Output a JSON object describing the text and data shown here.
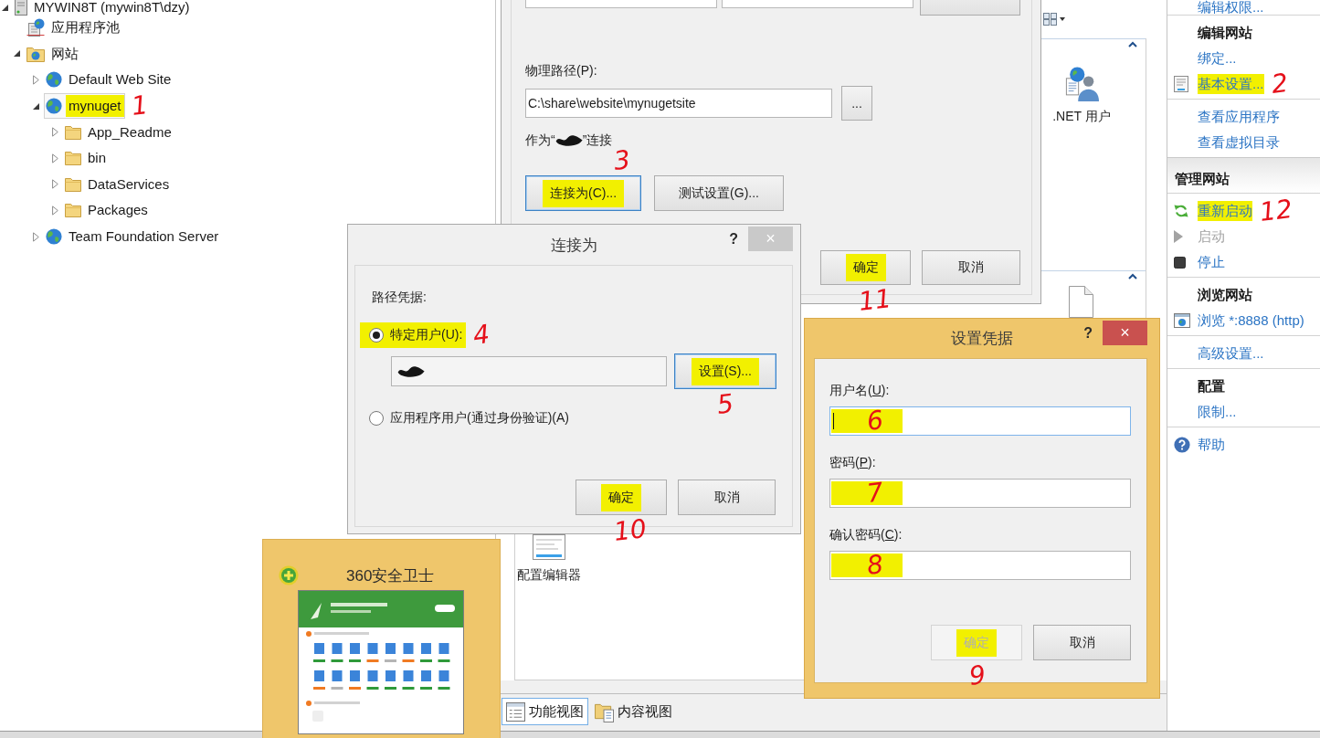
{
  "tree": {
    "items": [
      {
        "label": "MYWIN8T (mywin8T\\dzy)",
        "kind": "server",
        "expanded": true,
        "selected": false,
        "highlighted": false,
        "children": [
          {
            "label": "应用程序池",
            "kind": "pool",
            "selected": false,
            "highlighted": false
          },
          {
            "label": "网站",
            "kind": "sites",
            "expanded": true,
            "selected": false,
            "highlighted": false,
            "children": [
              {
                "label": "Default Web Site",
                "kind": "globe",
                "expanded": false,
                "selected": false,
                "highlighted": false
              },
              {
                "label": "mynuget",
                "kind": "globe",
                "expanded": true,
                "selected": true,
                "highlighted": true,
                "annotation": "1",
                "children": [
                  {
                    "label": "App_Readme",
                    "kind": "folder",
                    "expanded": false,
                    "selected": false,
                    "highlighted": false
                  },
                  {
                    "label": "bin",
                    "kind": "folder",
                    "expanded": false,
                    "selected": false,
                    "highlighted": false
                  },
                  {
                    "label": "DataServices",
                    "kind": "folder",
                    "expanded": false,
                    "selected": false,
                    "highlighted": false
                  },
                  {
                    "label": "Packages",
                    "kind": "folder",
                    "expanded": false,
                    "selected": false,
                    "highlighted": false
                  }
                ]
              },
              {
                "label": "Team Foundation Server",
                "kind": "globe",
                "expanded": false,
                "selected": false,
                "highlighted": false
              }
            ]
          }
        ]
      }
    ]
  },
  "site_dialog": {
    "top_row": [
      {
        "kind": "field"
      },
      {
        "kind": "field"
      },
      {
        "kind": "button"
      }
    ],
    "path_label": "物理路径(P):",
    "path_value": "C:\\share\\website\\mynugetsite",
    "browse_label": "...",
    "connect_note": {
      "before": "作为“",
      "after": "”连接",
      "redacted": true
    },
    "buttons": [
      {
        "label": "连接为(C)...",
        "focused": true,
        "disabled": false,
        "highlighted": true,
        "annotation": "3"
      },
      {
        "label": "测试设置(G)...",
        "focused": false,
        "disabled": false,
        "highlighted": false
      }
    ],
    "footer_buttons": [
      {
        "label": "确定",
        "focused": false,
        "disabled": false,
        "highlighted": true,
        "annotation": "11"
      },
      {
        "label": "取消",
        "focused": false,
        "disabled": false,
        "highlighted": false
      }
    ]
  },
  "feature_sections": [
    {
      "expanded": true,
      "tiles": [
        {
          "kind": "users",
          "label": ".NET 用户"
        }
      ]
    },
    {
      "expanded": true,
      "tiles": [
        {
          "kind": "document"
        }
      ]
    }
  ],
  "lower_tiles": [
    {
      "kind": "config",
      "label": "配置编辑器"
    }
  ],
  "actions": [
    {
      "kind": "block",
      "items": [
        {
          "kind": "link",
          "label": "编辑权限...",
          "disabled": false,
          "highlighted": false
        }
      ]
    },
    {
      "kind": "block",
      "items": [
        {
          "kind": "heading",
          "label": "编辑网站"
        },
        {
          "kind": "link",
          "label": "绑定...",
          "disabled": false,
          "highlighted": false
        },
        {
          "kind": "form",
          "label": "基本设置...",
          "disabled": false,
          "highlighted": true,
          "annotation": "2"
        }
      ]
    },
    {
      "kind": "block",
      "items": [
        {
          "kind": "link",
          "label": "查看应用程序",
          "disabled": false,
          "highlighted": false
        },
        {
          "kind": "link",
          "label": "查看虚拟目录",
          "disabled": false,
          "highlighted": false
        }
      ]
    },
    {
      "kind": "group",
      "label": "管理网站"
    },
    {
      "kind": "block",
      "items": [
        {
          "kind": "refresh",
          "label": "重新启动",
          "disabled": false,
          "highlighted": true,
          "annotation": "12"
        },
        {
          "kind": "play",
          "label": "启动",
          "disabled": true,
          "highlighted": false
        },
        {
          "kind": "stop",
          "label": "停止",
          "disabled": false,
          "highlighted": false
        }
      ]
    },
    {
      "kind": "block",
      "items": [
        {
          "kind": "heading",
          "label": "浏览网站"
        },
        {
          "kind": "browse",
          "label": "浏览 *:8888 (http)",
          "disabled": false,
          "highlighted": false
        }
      ]
    },
    {
      "kind": "block",
      "items": [
        {
          "kind": "link",
          "label": "高级设置...",
          "disabled": false,
          "highlighted": false
        }
      ]
    },
    {
      "kind": "block",
      "items": [
        {
          "kind": "heading",
          "label": "配置"
        },
        {
          "kind": "link",
          "label": "限制...",
          "disabled": false,
          "highlighted": false
        }
      ]
    },
    {
      "kind": "block",
      "items": [
        {
          "kind": "help",
          "label": "帮助",
          "disabled": false,
          "highlighted": false
        }
      ]
    }
  ],
  "connect_dialog": {
    "title": "连接为",
    "help_label": "?",
    "close_label": "×",
    "active": false,
    "section_label": "路径凭据:",
    "options": [
      {
        "label": "特定用户(U):",
        "selected": true,
        "highlighted": true,
        "annotation": "4"
      },
      {
        "label": "应用程序用户(通过身份验证)(A)",
        "selected": false,
        "highlighted": false
      }
    ],
    "user_field": {
      "redacted": true
    },
    "set_button": {
      "label": "设置(S)...",
      "focused": true,
      "disabled": false,
      "highlighted": true,
      "annotation": "5"
    },
    "buttons": [
      {
        "label": "确定",
        "focused": false,
        "disabled": false,
        "highlighted": true,
        "annotation": "10"
      },
      {
        "label": "取消",
        "focused": false,
        "disabled": false,
        "highlighted": false
      }
    ]
  },
  "credentials_dialog": {
    "title": "设置凭据",
    "help_label": "?",
    "close_label": "×",
    "active": true,
    "fields": [
      {
        "label_parts": [
          "用户名(",
          "U",
          "):"
        ],
        "focused": true,
        "highlighted": true,
        "annotation": "6"
      },
      {
        "label_parts": [
          "密码(",
          "P",
          "):"
        ],
        "focused": false,
        "highlighted": true,
        "annotation": "7"
      },
      {
        "label_parts": [
          "确认密码(",
          "C",
          "):"
        ],
        "focused": false,
        "highlighted": true,
        "annotation": "8"
      }
    ],
    "buttons": [
      {
        "label": "确定",
        "focused": false,
        "disabled": true,
        "highlighted": true,
        "annotation": "9"
      },
      {
        "label": "取消",
        "focused": false,
        "disabled": false,
        "highlighted": false
      }
    ]
  },
  "taskbar_preview": {
    "title": "360安全卫士"
  },
  "view_tabs": [
    {
      "kind": "features",
      "label": "功能视图",
      "selected": true
    },
    {
      "kind": "content",
      "label": "内容视图",
      "selected": false
    }
  ]
}
